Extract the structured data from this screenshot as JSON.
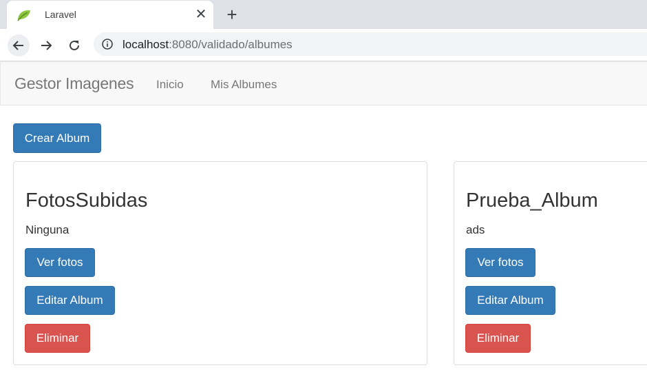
{
  "browser": {
    "tab_title": "Laravel",
    "close_symbol": "✕",
    "new_tab_symbol": "+",
    "url_host": "localhost",
    "url_path": ":8080/validado/albumes"
  },
  "navbar": {
    "brand": "Gestor Imagenes",
    "links": [
      "Inicio",
      "Mis Albumes"
    ]
  },
  "actions": {
    "create_album": "Crear Album"
  },
  "albums": [
    {
      "title": "FotosSubidas",
      "description": "Ninguna",
      "view_label": "Ver fotos",
      "edit_label": "Editar Album",
      "delete_label": "Eliminar"
    },
    {
      "title": "Prueba_Album",
      "description": "ads",
      "view_label": "Ver fotos",
      "edit_label": "Editar Album",
      "delete_label": "Eliminar"
    }
  ],
  "colors": {
    "primary": "#337ab7",
    "danger": "#d9534f",
    "navbar_bg": "#f8f8f8",
    "favicon": "#8dc63f"
  },
  "icons": [
    "laravel-favicon-icon",
    "close-icon",
    "plus-icon",
    "back-arrow-icon",
    "forward-arrow-icon",
    "reload-icon",
    "info-icon"
  ]
}
